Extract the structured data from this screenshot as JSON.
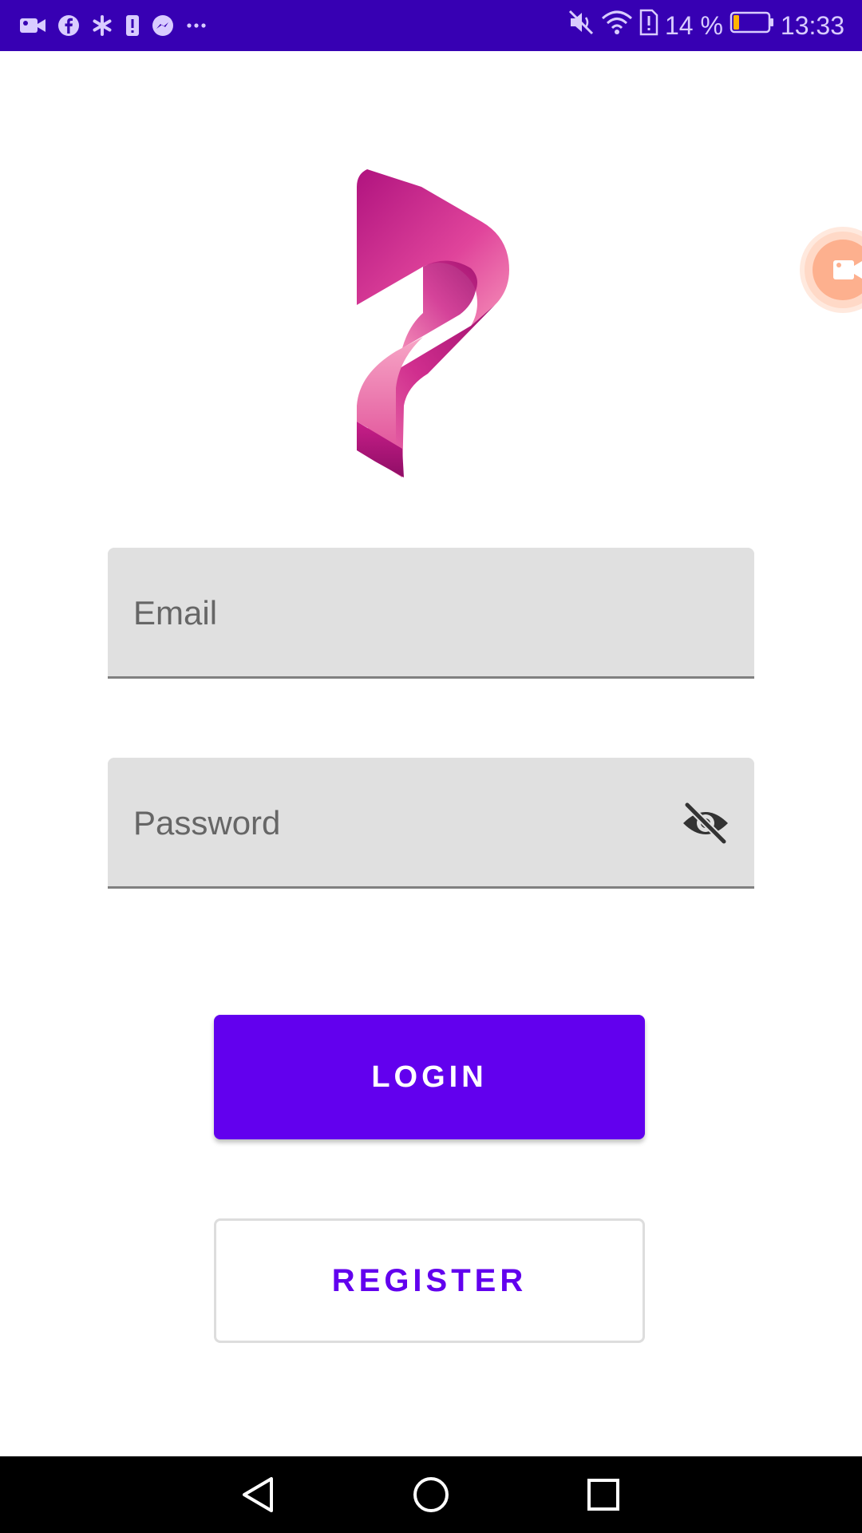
{
  "status_bar": {
    "battery_percent": "14 %",
    "time": "13:33",
    "left_icons": [
      "video-camera-icon",
      "facebook-icon",
      "asterisk-icon",
      "alert-icon",
      "messenger-icon",
      "more-dots-icon"
    ],
    "right_icons": [
      "mute-icon",
      "wifi-icon",
      "sim-alert-icon",
      "battery-icon"
    ],
    "battery_level": 0.14
  },
  "logo": {
    "name": "p-ribbon-logo",
    "colors": [
      "#c2188f",
      "#e0449b",
      "#f590b8"
    ]
  },
  "form": {
    "email": {
      "placeholder": "Email",
      "value": ""
    },
    "password": {
      "placeholder": "Password",
      "value": "",
      "visibility_icon": "eye-off-icon"
    }
  },
  "actions": {
    "login_label": "LOGIN",
    "register_label": "REGISTER"
  },
  "nav_bar": {
    "icons": [
      "back-triangle-icon",
      "home-circle-icon",
      "recents-square-icon"
    ]
  },
  "colors": {
    "status_bar": "#3700b3",
    "primary": "#6200ee",
    "field_background": "#e0e0e0",
    "field_underline": "#808080",
    "nav_bar": "#000000"
  }
}
